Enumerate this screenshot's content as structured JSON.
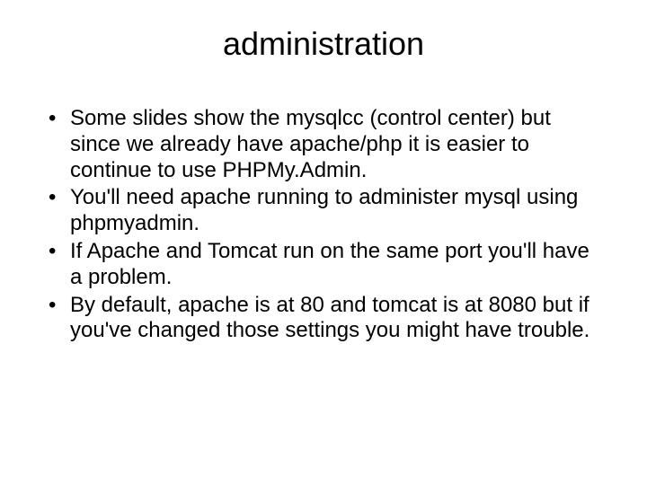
{
  "title": "administration",
  "bullets": [
    "Some slides show the mysqlcc (control center) but since we already have apache/php it is easier to continue to use PHPMy.Admin.",
    "You'll need apache running to administer mysql using phpmyadmin.",
    "If Apache and Tomcat run on the same port you'll have a problem.",
    "By default, apache is at 80 and tomcat is at 8080 but if you've changed those settings you might have trouble."
  ]
}
